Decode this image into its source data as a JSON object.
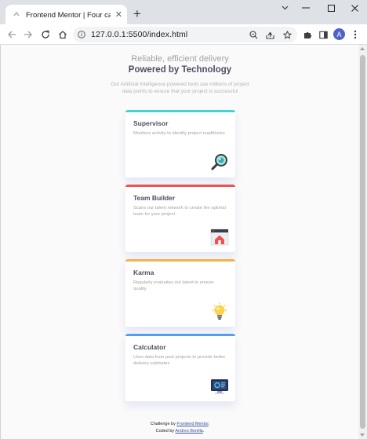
{
  "browser": {
    "tab_title": "Frontend Mentor | Four card feat",
    "url": "127.0.0.1:5500/index.html",
    "profile_initial": "A"
  },
  "page": {
    "header": {
      "subtitle": "Reliable, efficient delivery",
      "title": "Powered by Technology",
      "description": "Our Artificial Intelligence powered tools use millions of project data points to ensure that your project is successful"
    },
    "cards": [
      {
        "title": "Supervisor",
        "description": "Monitors activity to identify project roadblocks",
        "accent": "#44d3d2",
        "icon": "magnifier-icon"
      },
      {
        "title": "Team Builder",
        "description": "Scans our talent network to create the optimal team for your project",
        "accent": "#ea5454",
        "icon": "team-builder-icon"
      },
      {
        "title": "Karma",
        "description": "Regularly evaluates our talent to ensure quality",
        "accent": "#fcae4a",
        "icon": "lightbulb-icon"
      },
      {
        "title": "Calculator",
        "description": "Uses data from past projects to provide better delivery estimates",
        "accent": "#549ef2",
        "icon": "calculator-icon"
      }
    ],
    "footer": {
      "challenge_prefix": "Challenge by",
      "challenge_link": "Frontend Mentor",
      "challenge_suffix": ".",
      "coded_prefix": "Coded by",
      "coded_link": "Andres Bonilla",
      "coded_suffix": "."
    }
  }
}
